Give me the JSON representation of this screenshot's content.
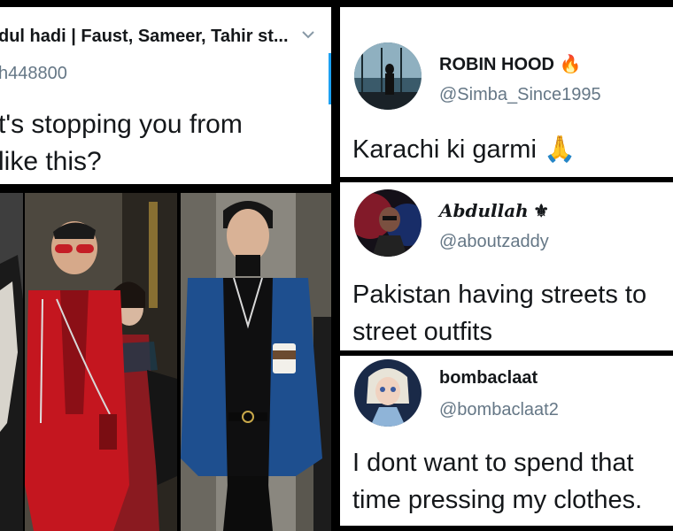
{
  "left_tweet": {
    "author": "dul hadi | Faust, Sameer, Tahir st...",
    "handle": "h448800",
    "chevron_icon": "chevron-down-icon",
    "text": "t's stopping you from\nlike this?"
  },
  "photos": [
    {
      "icon": "street-fashion-photo"
    },
    {
      "icon": "red-outfit-photo"
    },
    {
      "icon": "blue-blazer-photo"
    }
  ],
  "tweets": [
    {
      "name": "ROBIN HOOD",
      "emoji": "🔥",
      "handle": "@Simba_Since1995",
      "text": "Karachi ki garmi 🙏"
    },
    {
      "name": "Abdullah",
      "emoji": "⚜",
      "handle": "@aboutzaddy",
      "text": "Pakistan having streets to\nstreet outfits"
    },
    {
      "name": "bombaclaat",
      "emoji": "",
      "handle": "@bombaclaat2",
      "text": "I dont want to spend that\ntime pressing my clothes."
    }
  ],
  "colors": {
    "accent": "#1da1f2",
    "handle_gray": "#657786",
    "text": "#14171a"
  }
}
